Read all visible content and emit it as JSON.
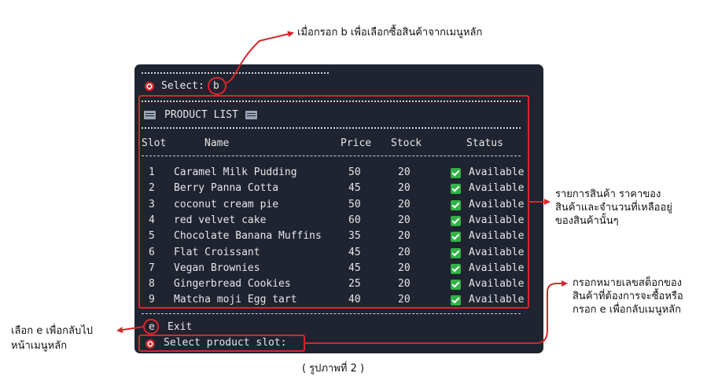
{
  "annotations": {
    "top": "เมื่อกรอก b เพื่อเลือกซื้อสินค้าจากเมนูหลัก",
    "right_list_1": "รายการสินค้า ราคาของ",
    "right_list_2": "สินค้าและจำนวนที่เหลืออยู่",
    "right_list_3": "ของสินค้านั้นๆ",
    "right_input_1": "กรอกหมายเลขสต็อกของ",
    "right_input_2": "สินค้าที่ต้องการจะซื้อหรือ",
    "right_input_3": "กรอก e เพื่อกลับเมนูหลัก",
    "left_1": "เลือก e เพื่อกลับไป",
    "left_2": "หน้าเมนูหลัก",
    "caption": "( รูปภาพที่ 2 )"
  },
  "terminal": {
    "select_prompt": "Select:",
    "select_value": "b",
    "list_title": "PRODUCT LIST",
    "headers": {
      "slot": "Slot",
      "name": "Name",
      "price": "Price",
      "stock": "Stock",
      "status": "Status"
    },
    "products": [
      {
        "slot": "1",
        "name": "Caramel Milk Pudding",
        "price": "50",
        "stock": "20",
        "status": "Available"
      },
      {
        "slot": "2",
        "name": "Berry Panna Cotta",
        "price": "45",
        "stock": "20",
        "status": "Available"
      },
      {
        "slot": "3",
        "name": "coconut cream pie",
        "price": "50",
        "stock": "20",
        "status": "Available"
      },
      {
        "slot": "4",
        "name": "red velvet cake",
        "price": "60",
        "stock": "20",
        "status": "Available"
      },
      {
        "slot": "5",
        "name": "Chocolate Banana Muffins",
        "price": "35",
        "stock": "20",
        "status": "Available"
      },
      {
        "slot": "6",
        "name": "Flat Croissant",
        "price": "45",
        "stock": "20",
        "status": "Available"
      },
      {
        "slot": "7",
        "name": "Vegan Brownies",
        "price": "45",
        "stock": "20",
        "status": "Available"
      },
      {
        "slot": "8",
        "name": "Gingerbread Cookies",
        "price": "25",
        "stock": "20",
        "status": "Available"
      },
      {
        "slot": "9",
        "name": "Matcha moji Egg tart",
        "price": "40",
        "stock": "20",
        "status": "Available"
      }
    ],
    "exit_key": "e",
    "exit_label": "Exit",
    "slot_prompt": "Select product slot:"
  },
  "colors": {
    "terminal_bg": "#1f2430",
    "annotation_red": "#d8262b",
    "check_green": "#2fb344"
  }
}
